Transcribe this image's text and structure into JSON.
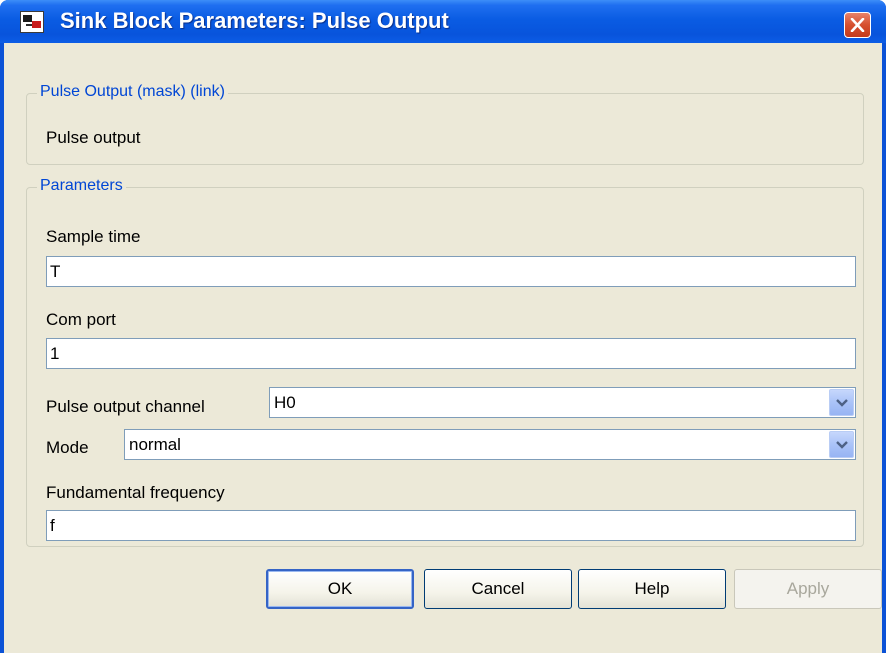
{
  "window": {
    "title": "Sink Block Parameters: Pulse Output"
  },
  "mask_group": {
    "legend": "Pulse Output (mask) (link)",
    "description": "Pulse output"
  },
  "params_group": {
    "legend": "Parameters",
    "sample_time": {
      "label": "Sample time",
      "value": "T"
    },
    "com_port": {
      "label": "Com port",
      "value": "1"
    },
    "pulse_channel": {
      "label": "Pulse output channel",
      "value": "H0"
    },
    "mode": {
      "label": "Mode",
      "value": "normal"
    },
    "fundamental_frequency": {
      "label": "Fundamental frequency",
      "value": "f"
    }
  },
  "buttons": {
    "ok": "OK",
    "cancel": "Cancel",
    "help": "Help",
    "apply": "Apply"
  },
  "icons": {
    "app": "simulink-block-icon",
    "close": "close-icon",
    "dropdown": "chevron-down-icon"
  },
  "colors": {
    "titlebar": "#0a5ce3",
    "dialog_bg": "#ece9d8",
    "group_legend": "#0046d5",
    "close_button": "#d6502f"
  }
}
